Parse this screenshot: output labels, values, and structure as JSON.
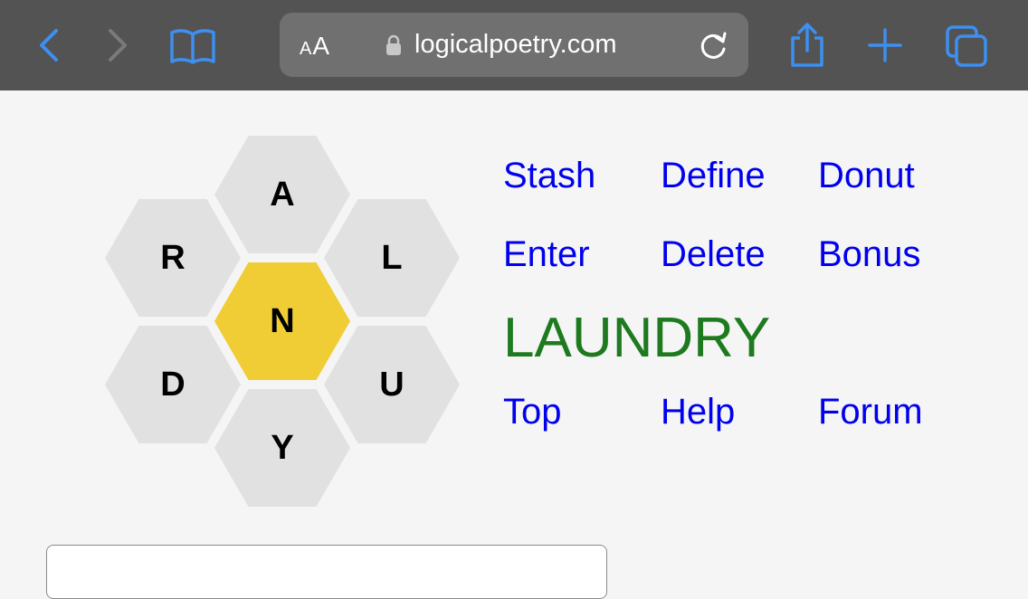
{
  "browser": {
    "back_icon": "chevron-left-icon",
    "forward_icon": "chevron-right-icon",
    "bookmarks_icon": "open-book-icon",
    "text_size_label": "AA",
    "text_size_small": "A",
    "text_size_large": "A",
    "lock_icon": "lock-icon",
    "url": "logicalpoetry.com",
    "reload_icon": "reload-icon",
    "share_icon": "share-icon",
    "new_tab_icon": "plus-icon",
    "tabs_icon": "tabs-icon",
    "accent_color": "#3d8ff0"
  },
  "puzzle": {
    "center_letter": "N",
    "outer_letters": [
      "A",
      "L",
      "U",
      "Y",
      "D",
      "R"
    ],
    "center_color": "#f0cd34",
    "outer_color": "#e1e1e1"
  },
  "menu": {
    "stash": "Stash",
    "define": "Define",
    "donut": "Donut",
    "enter": "Enter",
    "delete": "Delete",
    "bonus": "Bonus",
    "top": "Top",
    "help": "Help",
    "forum": "Forum",
    "link_color": "#0000ee"
  },
  "current_word": {
    "text": "LAUNDRY",
    "color": "#1e7a1e"
  },
  "word_input": {
    "value": ""
  }
}
